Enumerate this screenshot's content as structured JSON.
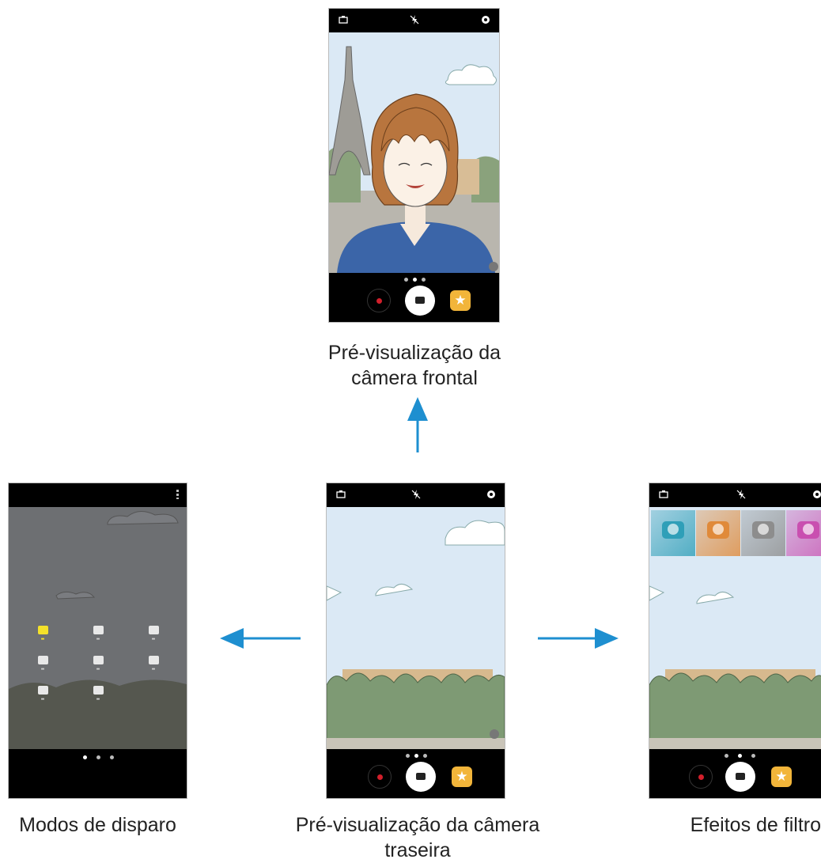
{
  "captions": {
    "front": "Pré-visualização da câmera frontal",
    "front_line1": "Pré-visualização da",
    "front_line2": "câmera frontal",
    "modes": "Modos de disparo",
    "rear_line1": "Pré-visualização da câmera",
    "rear_line2": "traseira",
    "filters": "Efeitos de filtro"
  },
  "colors": {
    "arrow": "#1e8fd0",
    "sky": "#dbe9f5",
    "record_dot": "#d21f2b",
    "effects_button": "#f2b53a",
    "mode_selected": "#f4e12a"
  },
  "icons": {
    "status": [
      "switch-camera-icon",
      "flash-off-icon",
      "settings-icon"
    ],
    "bottom": [
      "record-icon",
      "shutter-icon",
      "effects-star-icon"
    ]
  },
  "page_indicator": {
    "count": 3,
    "active": 2
  },
  "shooting_modes": [
    {
      "icon": "camera-icon",
      "selected": true
    },
    {
      "icon": "pro-icon"
    },
    {
      "icon": "panorama-icon"
    },
    {
      "icon": "selective-focus-icon"
    },
    {
      "icon": "video-collage-icon"
    },
    {
      "icon": "night-icon"
    },
    {
      "icon": "hyperlapse-icon"
    },
    {
      "icon": "food-icon"
    }
  ],
  "filters": [
    {
      "tint": "#2f9fb8"
    },
    {
      "tint": "#e08a3a"
    },
    {
      "tint": "#8d8d8d"
    },
    {
      "tint": "#c94fb0"
    }
  ]
}
